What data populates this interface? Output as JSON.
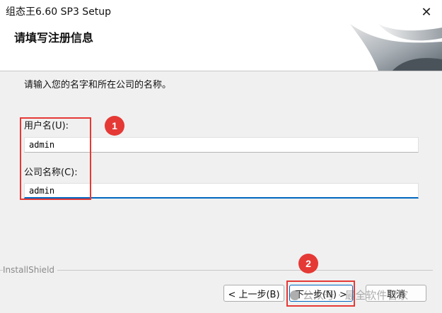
{
  "window": {
    "title": "组态王6.60 SP3 Setup",
    "close_glyph": "✕"
  },
  "header": {
    "heading": "请填写注册信息"
  },
  "main": {
    "instruction": "请输入您的名字和所在公司的名称。",
    "user_label": "用户名(U):",
    "user_value": "admin",
    "company_label": "公司名称(C):",
    "company_value": "admin"
  },
  "annotations": {
    "badge_1": "1",
    "badge_2": "2"
  },
  "footer": {
    "brand": "InstallShield",
    "back_label": "< 上一步(B)",
    "next_label": "下一步(N) >",
    "cancel_label": "取消"
  },
  "watermark": {
    "text": "公众号 · 最全软件管家"
  },
  "colors": {
    "accent": "#0067c0",
    "annotation_red": "#e53935"
  }
}
